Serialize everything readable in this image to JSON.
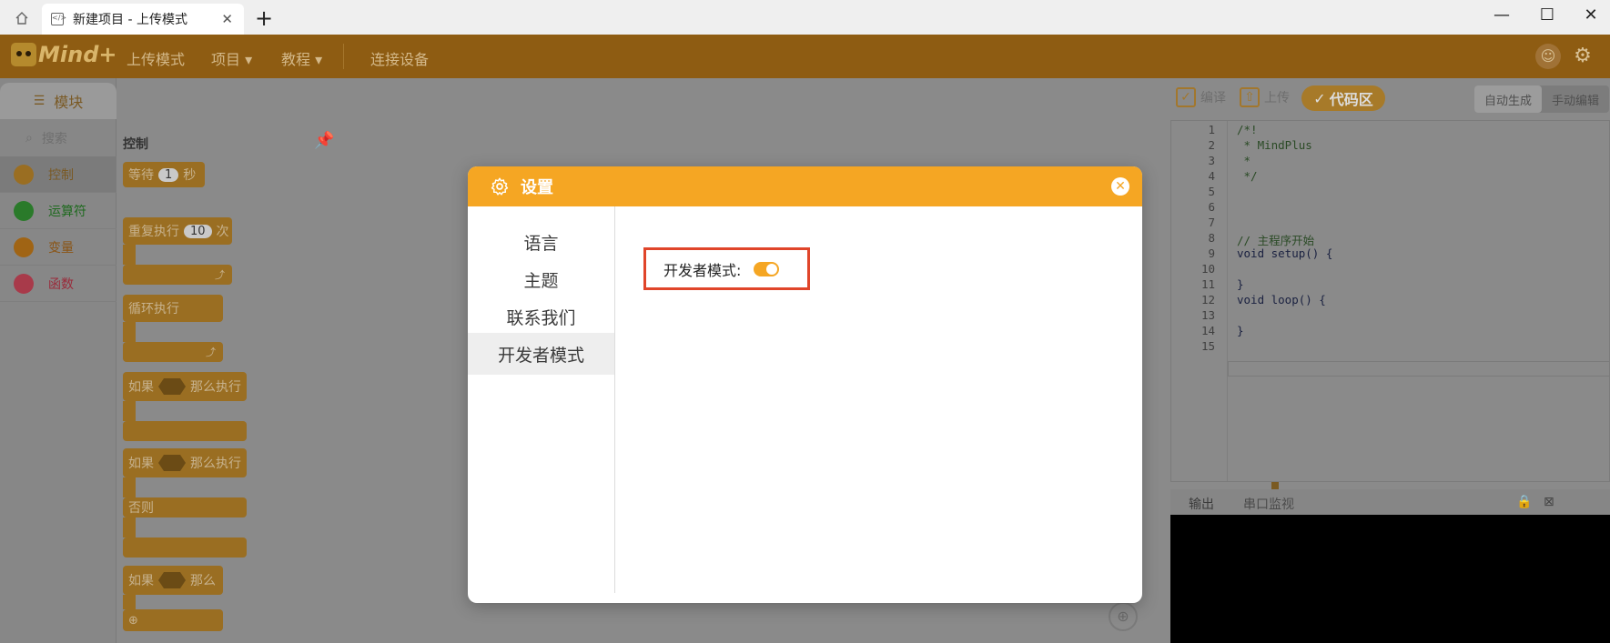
{
  "browser": {
    "tab_title": "新建项目 - 上传模式",
    "new_tab_label": "+",
    "window_controls": [
      "—",
      "☐",
      "✕"
    ]
  },
  "app": {
    "logo_text": "Mind+",
    "nav": {
      "mode": "上传模式",
      "project": "项目 ▾",
      "tutorial": "教程 ▾",
      "connect": "连接设备"
    }
  },
  "sidebar": {
    "module_tab": "模块",
    "search_placeholder": "搜索",
    "categories": [
      {
        "label": "控制",
        "color": "#9a6e22",
        "text_color": "#7a5a25"
      },
      {
        "label": "运算符",
        "color": "#2a7a2a",
        "text_color": "#1e6a1e"
      },
      {
        "label": "变量",
        "color": "#a06414",
        "text_color": "#8a5414"
      },
      {
        "label": "函数",
        "color": "#a83a4a",
        "text_color": "#9a2a3a"
      }
    ]
  },
  "blocks": {
    "section_title": "控制",
    "wait": {
      "label": "等待",
      "value": "1",
      "unit": "秒"
    },
    "repeat": {
      "label": "重复执行",
      "value": "10",
      "unit": "次"
    },
    "loop": {
      "label": "循环执行"
    },
    "if_then": {
      "if": "如果",
      "then": "那么执行"
    },
    "if_then_else": {
      "if": "如果",
      "then": "那么执行",
      "else": "否则"
    },
    "if_then_plus": {
      "if": "如果",
      "then": "那么"
    }
  },
  "code_panel": {
    "compile": "编译",
    "upload": "上传",
    "code_zone": "代码区",
    "auto_gen": "自动生成",
    "manual_edit": "手动编辑",
    "lines": [
      "/*!",
      " * MindPlus",
      " *",
      " */",
      "",
      "",
      "",
      "// 主程序开始",
      "void setup() {",
      "",
      "}",
      "void loop() {",
      "",
      "}",
      ""
    ],
    "output_tab": "输出",
    "serial_tab": "串口监视"
  },
  "modal": {
    "title": "设置",
    "menu": [
      {
        "label": "语言",
        "active": false
      },
      {
        "label": "主题",
        "active": false
      },
      {
        "label": "联系我们",
        "active": false
      },
      {
        "label": "开发者模式",
        "active": true
      }
    ],
    "dev_mode_label": "开发者模式:",
    "dev_mode_enabled": true,
    "accent": "#f5a623",
    "highlight": "#e0452a"
  }
}
